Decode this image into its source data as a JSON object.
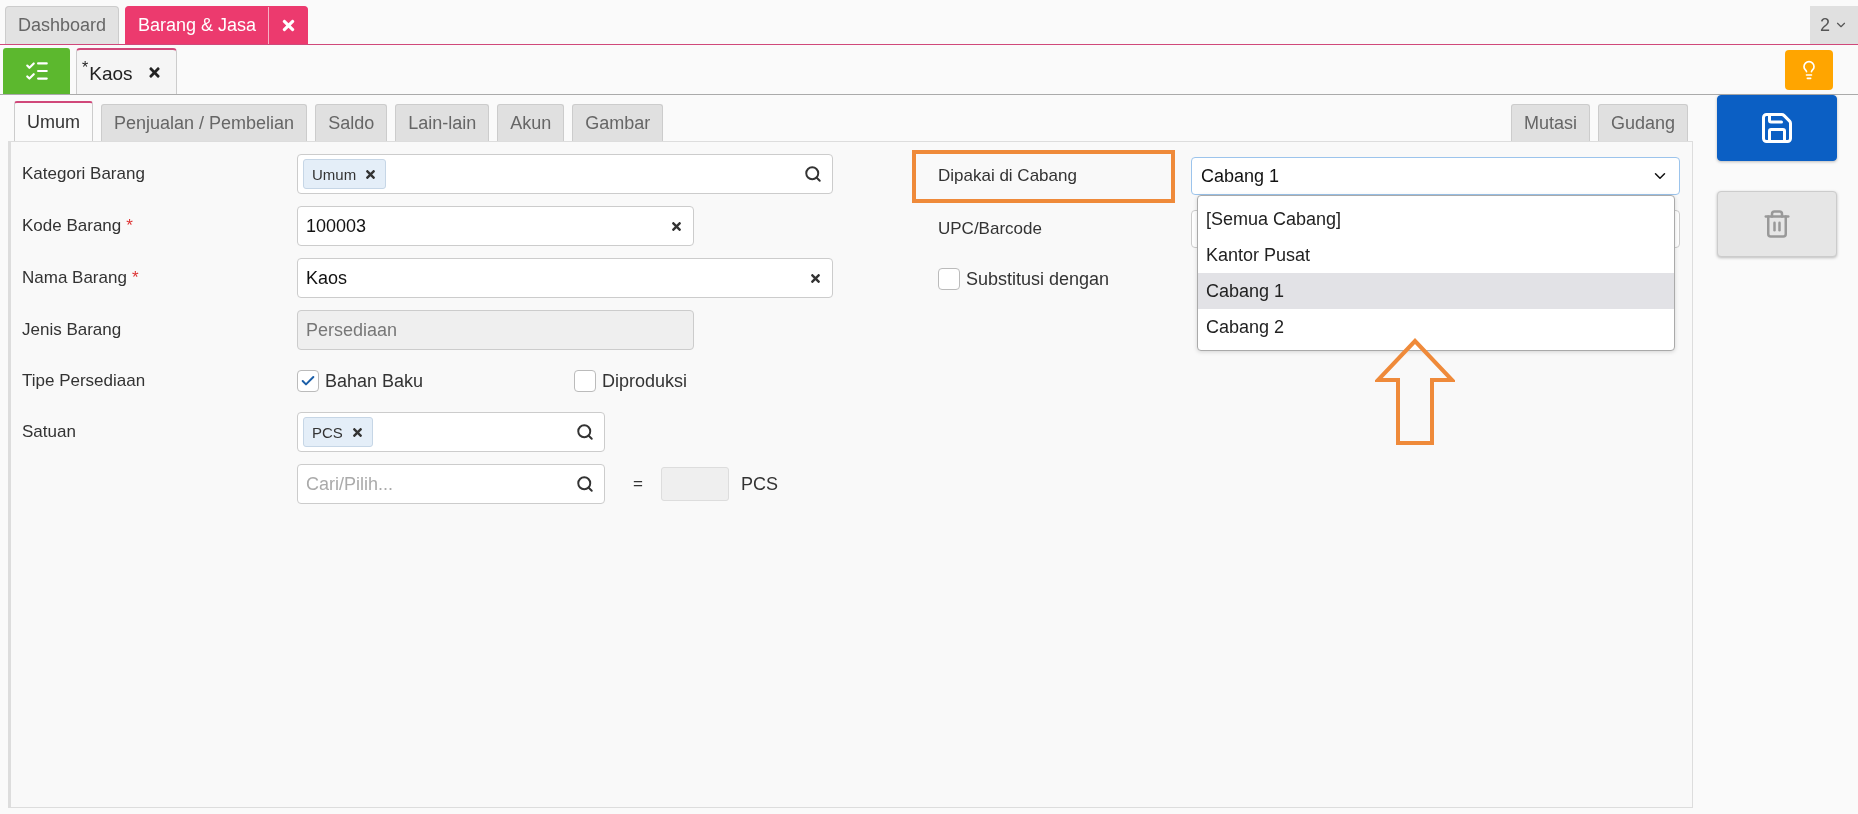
{
  "app_tabs": [
    {
      "label": "Dashboard",
      "selected": false,
      "closable": false
    },
    {
      "label": "Barang & Jasa",
      "selected": true,
      "closable": true
    }
  ],
  "tab_counter": "2",
  "document_tabs": [
    {
      "mark": "*",
      "label": "Kaos",
      "selected": true
    }
  ],
  "section_tabs": [
    {
      "label": "Umum",
      "selected": true
    },
    {
      "label": "Penjualan / Pembelian",
      "selected": false
    },
    {
      "label": "Saldo",
      "selected": false
    },
    {
      "label": "Lain-lain",
      "selected": false
    },
    {
      "label": "Akun",
      "selected": false
    },
    {
      "label": "Gambar",
      "selected": false
    }
  ],
  "side_tabs": [
    {
      "label": "Mutasi",
      "selected": false
    },
    {
      "label": "Gudang",
      "selected": false
    }
  ],
  "left_fields": [
    {
      "kind": "tags",
      "label": "Kategori Barang",
      "required": false,
      "tags": [
        "Umum"
      ]
    },
    {
      "kind": "text",
      "label": "Kode Barang",
      "required": true,
      "value": "100003"
    },
    {
      "kind": "text",
      "label": "Nama Barang",
      "required": true,
      "value": "Kaos"
    },
    {
      "kind": "disabled",
      "label": "Jenis Barang",
      "required": false,
      "value": "Persediaan"
    },
    {
      "kind": "checks",
      "label": "Tipe Persediaan",
      "required": false,
      "options": [
        {
          "label": "Bahan Baku",
          "checked": true
        },
        {
          "label": "Diproduksi",
          "checked": false
        }
      ]
    },
    {
      "kind": "tags",
      "label": "Satuan",
      "required": false,
      "tags": [
        "PCS"
      ]
    },
    {
      "kind": "conversion",
      "placeholder": "Cari/Pilih...",
      "equals": "=",
      "unit": "PCS"
    }
  ],
  "right_fields": [
    {
      "kind": "select",
      "label": "Dipakai di Cabang",
      "highlighted": true,
      "value": "Cabang 1",
      "open": true,
      "options": [
        {
          "label": "[Semua Cabang]",
          "selected": false
        },
        {
          "label": "Kantor Pusat",
          "selected": false
        },
        {
          "label": "Cabang 1",
          "selected": true
        },
        {
          "label": "Cabang 2",
          "selected": false
        }
      ],
      "pointer_arrow": true
    },
    {
      "kind": "text",
      "label": "UPC/Barcode",
      "highlighted": false
    },
    {
      "kind": "check",
      "label": "Substitusi dengan",
      "checked": false,
      "highlighted": false
    }
  ],
  "actions": [
    {
      "kind": "save",
      "disabled": false
    },
    {
      "kind": "delete",
      "disabled": true
    }
  ]
}
